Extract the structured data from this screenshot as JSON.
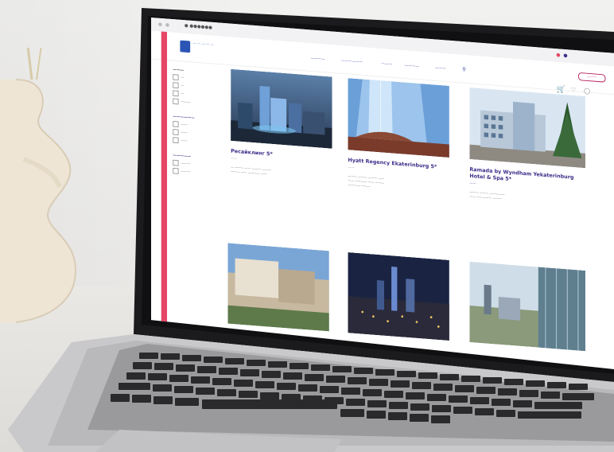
{
  "browser": {
    "url": "● ●●●●●●"
  },
  "header": {
    "logo_text": "— — — — —",
    "nav": [
      "————",
      "——————",
      "———",
      "————",
      "———"
    ],
    "account_button": "———",
    "icons": [
      "search-icon",
      "cart-icon",
      "heart-icon",
      "user-icon"
    ]
  },
  "filters": [
    {
      "title": "———",
      "options": [
        "—",
        "—",
        "—",
        "———"
      ]
    },
    {
      "title": "——————",
      "options": [
        "——",
        "——",
        "——"
      ]
    },
    {
      "title": "—————",
      "options": [
        "———",
        "———"
      ]
    }
  ],
  "hotels": [
    {
      "title": "Ресайклинг 5*",
      "tag": "——",
      "desc": [
        "— ——— —— ——— ———",
        "——— —— ———— ——"
      ]
    },
    {
      "title": "Hyatt Regency Ekaterinburg 5*",
      "tag": "——",
      "desc": [
        "——— ——— ——— ——",
        "—— ———— —— ———",
        "———— ———"
      ]
    },
    {
      "title": "Ramada by Wyndham Yekaterinburg Hotel & Spa 5*",
      "tag": "——",
      "desc": [
        "——— ——— —————",
        "—— ————— ———"
      ]
    }
  ],
  "colors": {
    "accent": "#3b2f8a",
    "strip": "#e64565",
    "link": "#2a55b4"
  }
}
